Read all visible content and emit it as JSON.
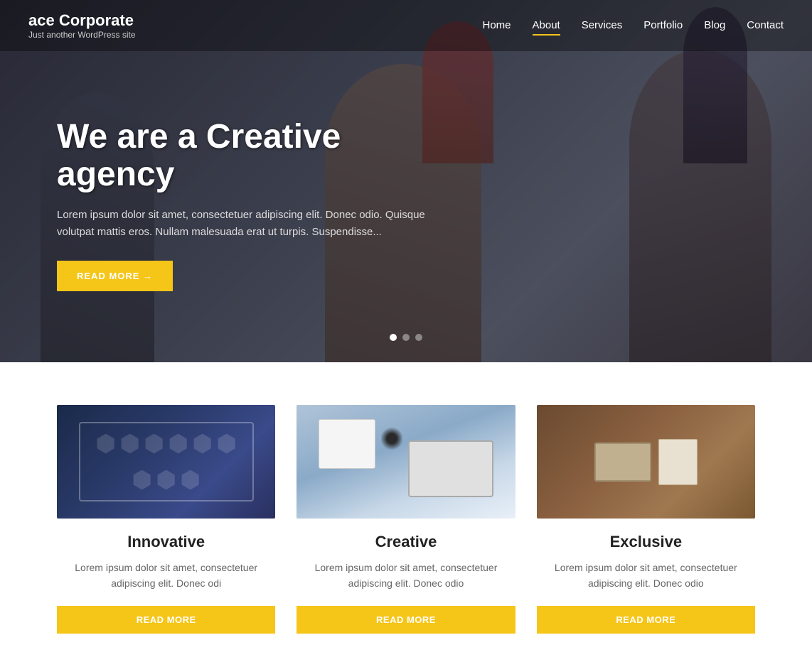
{
  "site": {
    "title": "ace Corporate",
    "subtitle": "Just another WordPress site"
  },
  "nav": {
    "items": [
      {
        "label": "Home",
        "active": false
      },
      {
        "label": "About",
        "active": true
      },
      {
        "label": "Services",
        "active": false
      },
      {
        "label": "Portfolio",
        "active": false
      },
      {
        "label": "Blog",
        "active": false
      },
      {
        "label": "Contact",
        "active": false
      }
    ]
  },
  "hero": {
    "title": "We are a Creative agency",
    "description": "Lorem ipsum dolor sit amet, consectetuer adipiscing elit. Donec odio. Quisque volutpat mattis eros. Nullam malesuada erat ut turpis. Suspendisse...",
    "button_label": "READ MORE →",
    "dots": [
      true,
      false,
      false
    ]
  },
  "cards": [
    {
      "title": "Innovative",
      "description": "Lorem ipsum dolor sit amet, consectetuer adipiscing elit. Donec odi",
      "button_label": "READ MORE"
    },
    {
      "title": "Creative",
      "description": "Lorem ipsum dolor sit amet, consectetuer adipiscing elit. Donec odio",
      "button_label": "READ MORE"
    },
    {
      "title": "Exclusive",
      "description": "Lorem ipsum dolor sit amet, consectetuer adipiscing elit. Donec odio",
      "button_label": "READ MORE"
    }
  ]
}
